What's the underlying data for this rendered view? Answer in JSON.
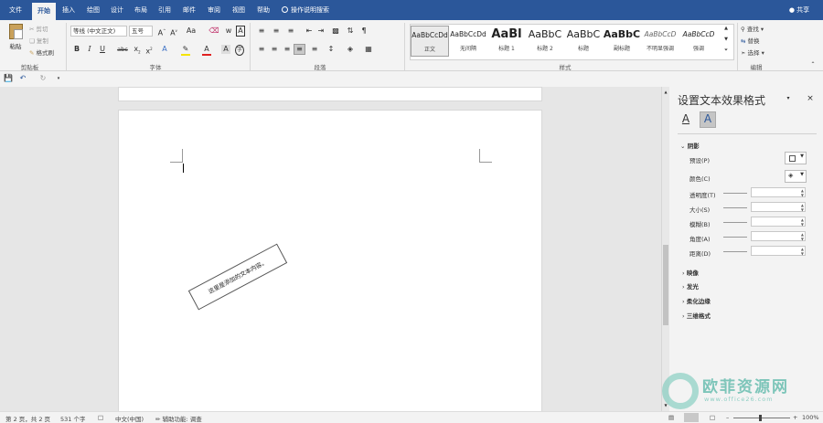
{
  "tabs": [
    "文件",
    "开始",
    "插入",
    "绘图",
    "设计",
    "布局",
    "引用",
    "邮件",
    "审阅",
    "视图",
    "帮助"
  ],
  "tellme": "操作说明搜索",
  "share": "共享",
  "clipboard": {
    "paste": "粘贴",
    "cut": "剪切",
    "copy": "复制",
    "format_painter": "格式刷",
    "group": "剪贴板"
  },
  "font": {
    "name": "等线 (中文正文)",
    "size": "五号",
    "group": "字体"
  },
  "paragraph": {
    "group": "段落"
  },
  "styles": {
    "group": "样式",
    "items": [
      {
        "preview": "AaBbCcDd",
        "name": "正文"
      },
      {
        "preview": "AaBbCcDd",
        "name": "无间隔"
      },
      {
        "preview": "AaBl",
        "name": "标题 1"
      },
      {
        "preview": "AaBbC",
        "name": "标题 2"
      },
      {
        "preview": "AaBbC",
        "name": "标题"
      },
      {
        "preview": "AaBbC",
        "name": "副标题"
      },
      {
        "preview": "AaBbCcD",
        "name": "不明显强调"
      },
      {
        "preview": "AaBbCcD",
        "name": "强调"
      }
    ]
  },
  "editing": {
    "find": "查找",
    "replace": "替换",
    "select": "选择",
    "group": "编辑"
  },
  "document": {
    "textbox_text": "这里是添加的文本内容。"
  },
  "pane": {
    "title": "设置文本效果格式",
    "shadow": {
      "heading": "阴影",
      "preset": "预设(P)",
      "color": "颜色(C)",
      "transparency": "透明度(T)",
      "size": "大小(S)",
      "blur": "模糊(B)",
      "angle": "角度(A)",
      "distance": "距离(D)"
    },
    "sections": [
      "映像",
      "发光",
      "柔化边缘",
      "三维格式"
    ]
  },
  "status": {
    "page": "第 2 页，共 2 页",
    "words": "531 个字",
    "language": "中文(中国)",
    "accessibility": "辅助功能: 调查",
    "zoom": "100%"
  },
  "watermark": {
    "brand": "欧菲资源网",
    "url": "www.office26.com"
  },
  "colors": {
    "accent": "#2b579a",
    "ribbon_bg": "#f3f3f3"
  }
}
